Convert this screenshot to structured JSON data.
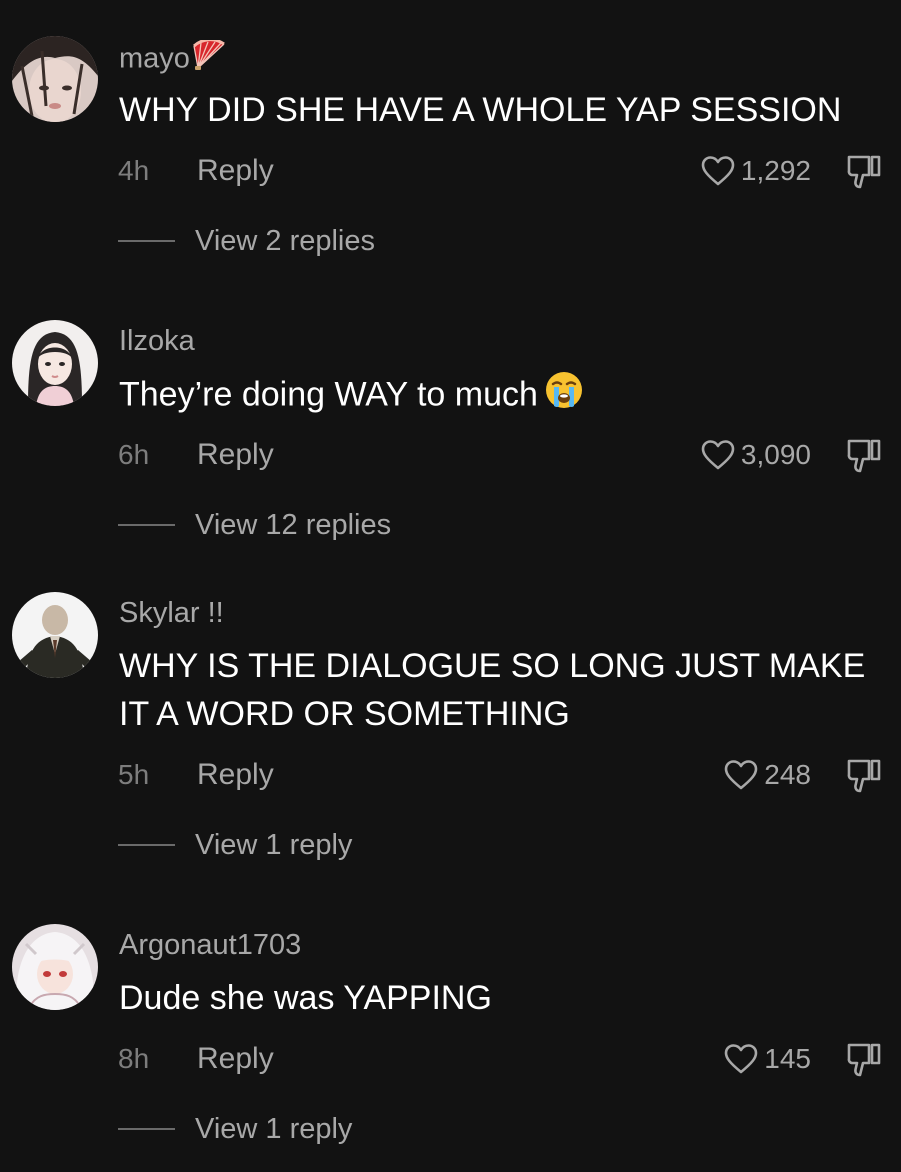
{
  "comments": [
    {
      "username": "mayo",
      "username_badge": "folding-fan-emoji",
      "text": "WHY DID SHE HAVE A WHOLE YAP SESSION",
      "time": "4h",
      "reply_label": "Reply",
      "likes": "1,292",
      "view_replies": "View 2 replies"
    },
    {
      "username": "Ilzoka",
      "text": "They’re doing WAY to much",
      "text_emoji": "loudly-crying-face-emoji",
      "time": "6h",
      "reply_label": "Reply",
      "likes": "3,090",
      "view_replies": "View 12 replies"
    },
    {
      "username": "Skylar  !!",
      "text": "WHY IS THE DIALOGUE SO LONG JUST MAKE IT A WORD OR SOMETHING",
      "time": "5h",
      "reply_label": "Reply",
      "likes": "248",
      "view_replies": "View 1 reply"
    },
    {
      "username": "Argonaut1703",
      "text": "Dude she was YAPPING",
      "time": "8h",
      "reply_label": "Reply",
      "likes": "145",
      "view_replies": "View 1 reply"
    }
  ],
  "icons": {
    "like": "heart-outline-icon",
    "dislike": "thumbs-down-outline-icon"
  },
  "colors": {
    "background": "#121212",
    "primary_text": "#ffffff",
    "secondary_text": "#a8a8a8",
    "muted_text": "#7d7d7d"
  }
}
